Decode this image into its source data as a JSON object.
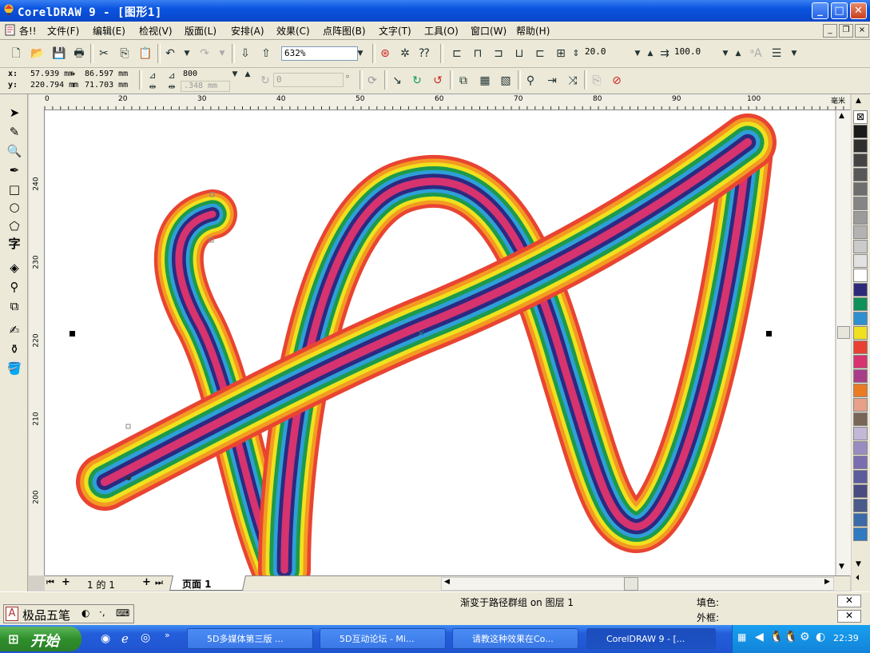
{
  "window": {
    "title": "CorelDRAW 9 - [图形1]",
    "minimize": "_",
    "maximize": "□",
    "close": "✕"
  },
  "menu": {
    "items": [
      "各!!",
      "文件(F)",
      "编辑(E)",
      "检视(V)",
      "版面(L)",
      "安排(A)",
      "效果(C)",
      "点阵图(B)",
      "文字(T)",
      "工具(O)",
      "窗口(W)",
      "帮助(H)"
    ],
    "mdi_min": "_",
    "mdi_restore": "❐",
    "mdi_close": "×"
  },
  "toolbar1": {
    "zoom": "632%",
    "width_value": "20.0",
    "height_value": "100.0"
  },
  "toolbar2": {
    "x_label": "x:",
    "y_label": "y:",
    "x_value": "57.939 mm",
    "y_value": "220.794 mm",
    "w_value": "86.597 mm",
    "h_value": "71.703 mm",
    "steps_value": "800",
    "offset_value": ".348 mm",
    "angle_value": "0",
    "angle_unit": "°"
  },
  "ruler": {
    "h_ticks": [
      "0",
      "20",
      "30",
      "40",
      "50",
      "60",
      "70",
      "80",
      "90",
      "100"
    ],
    "h_unit": "毫米",
    "v_ticks": [
      "240",
      "230",
      "220",
      "210",
      "200"
    ]
  },
  "pagebar": {
    "counter": "1 的 1",
    "tab": "页面 1"
  },
  "status": {
    "message": "渐变于路径群组 on 图层 1",
    "fill_label": "填色:",
    "outline_label": "外框:",
    "ime_name": "极品五笔"
  },
  "taskbar": {
    "start": "开始",
    "tasks": [
      "5D多媒体第三版 ...",
      "5D互动论坛 - Mi...",
      "请教这种效果在Co...",
      "CorelDRAW 9 - [..."
    ],
    "clock": "22:39"
  },
  "palette": {
    "colors": [
      "#1a1a1a",
      "#2f2f2f",
      "#444444",
      "#585858",
      "#6e6e6e",
      "#858585",
      "#9b9b9b",
      "#b3b3b3",
      "#cacaca",
      "#e2e2e2",
      "#ffffff",
      "#2e2a7a",
      "#10915a",
      "#2f8fcf",
      "#f0e020",
      "#e84033",
      "#d8336e",
      "#a83e8a",
      "#ea7b23",
      "#e8a08a",
      "#786658",
      "#c3b8d8",
      "#9a8cc0",
      "#7a6eb0",
      "#5d5c9c",
      "#4a4b80",
      "#4a5a8a",
      "#3b6aa8",
      "#2f7ac0"
    ]
  }
}
